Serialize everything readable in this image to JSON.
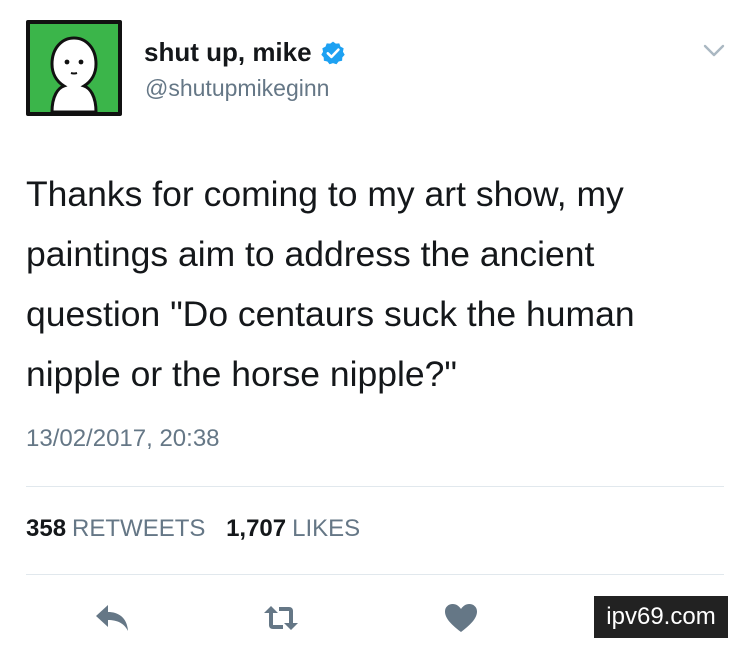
{
  "author": {
    "display_name": "shut up, mike",
    "handle": "@shutupmikeginn",
    "verified": true,
    "avatar_bg": "#3bb54a"
  },
  "tweet": {
    "text_lines": [
      "Thanks for coming to my art show, my",
      "paintings aim to address the ancient",
      "question \"Do centaurs suck the human",
      "nipple or the horse nipple?\""
    ],
    "timestamp": "13/02/2017, 20:38"
  },
  "stats": {
    "retweets_count": "358",
    "retweets_label": "RETWEETS",
    "likes_count": "1,707",
    "likes_label": "LIKES"
  },
  "actions": {
    "icons": [
      "reply-icon",
      "retweet-icon",
      "like-icon",
      "direct-message-icon"
    ],
    "icon_color": "#657786"
  },
  "watermark": "ipv69.com"
}
